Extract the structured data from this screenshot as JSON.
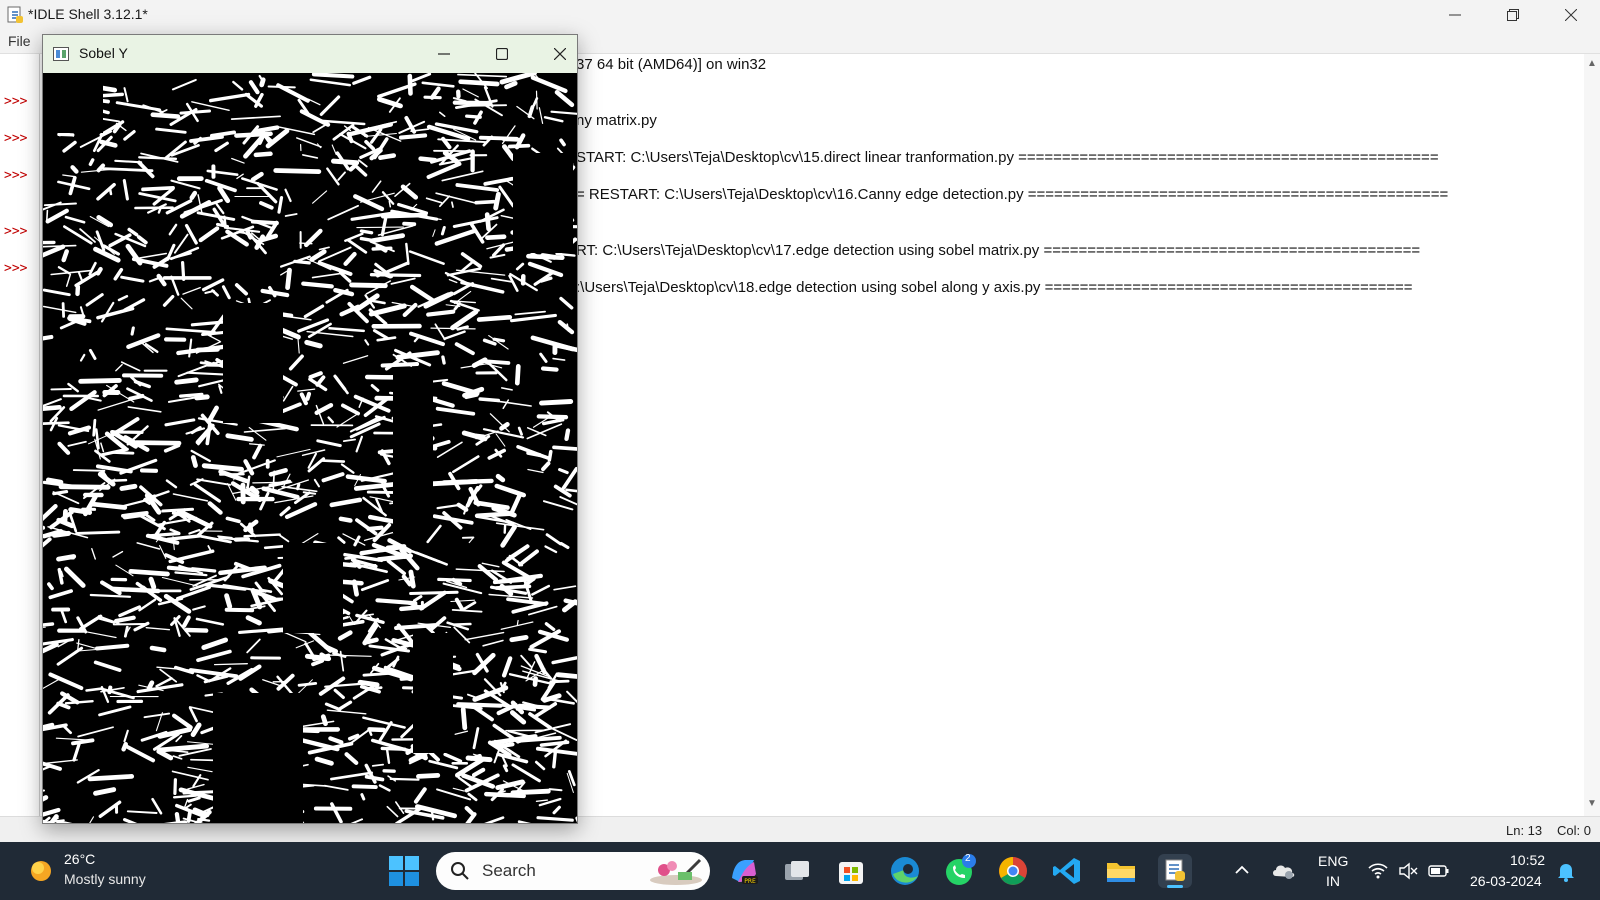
{
  "idle": {
    "title": "*IDLE Shell 3.12.1*",
    "menu_file": "File",
    "lines": [
      "37 64 bit (AMD64)] on win32",
      "ny matrix.py",
      "START: C:\\Users\\Teja\\Desktop\\cv\\15.direct linear tranformation.py ================================================",
      "= RESTART: C:\\Users\\Teja\\Desktop\\cv\\16.Canny edge detection.py ================================================",
      "RT: C:\\Users\\Teja\\Desktop\\cv\\17.edge detection using sobel matrix.py ===========================================",
      ":\\Users\\Teja\\Desktop\\cv\\18.edge detection using sobel along y axis.py =========================================="
    ],
    "prompts": [
      ">>>",
      ">>>",
      ">>>",
      ">>>",
      ">>>"
    ],
    "status_ln": "Ln: 13",
    "status_col": "Col: 0"
  },
  "sobel_window": {
    "title": "Sobel Y"
  },
  "taskbar": {
    "weather_temp": "26°C",
    "weather_desc": "Mostly sunny",
    "search_label": "Search",
    "whatsapp_badge": "2",
    "lang_line1": "ENG",
    "lang_line2": "IN",
    "time": "10:52",
    "date": "26-03-2024"
  },
  "colors": {
    "taskbar_bg": "#202a36",
    "prompt_red": "#c00000",
    "sobel_titlebar": "#e9f3e4"
  }
}
